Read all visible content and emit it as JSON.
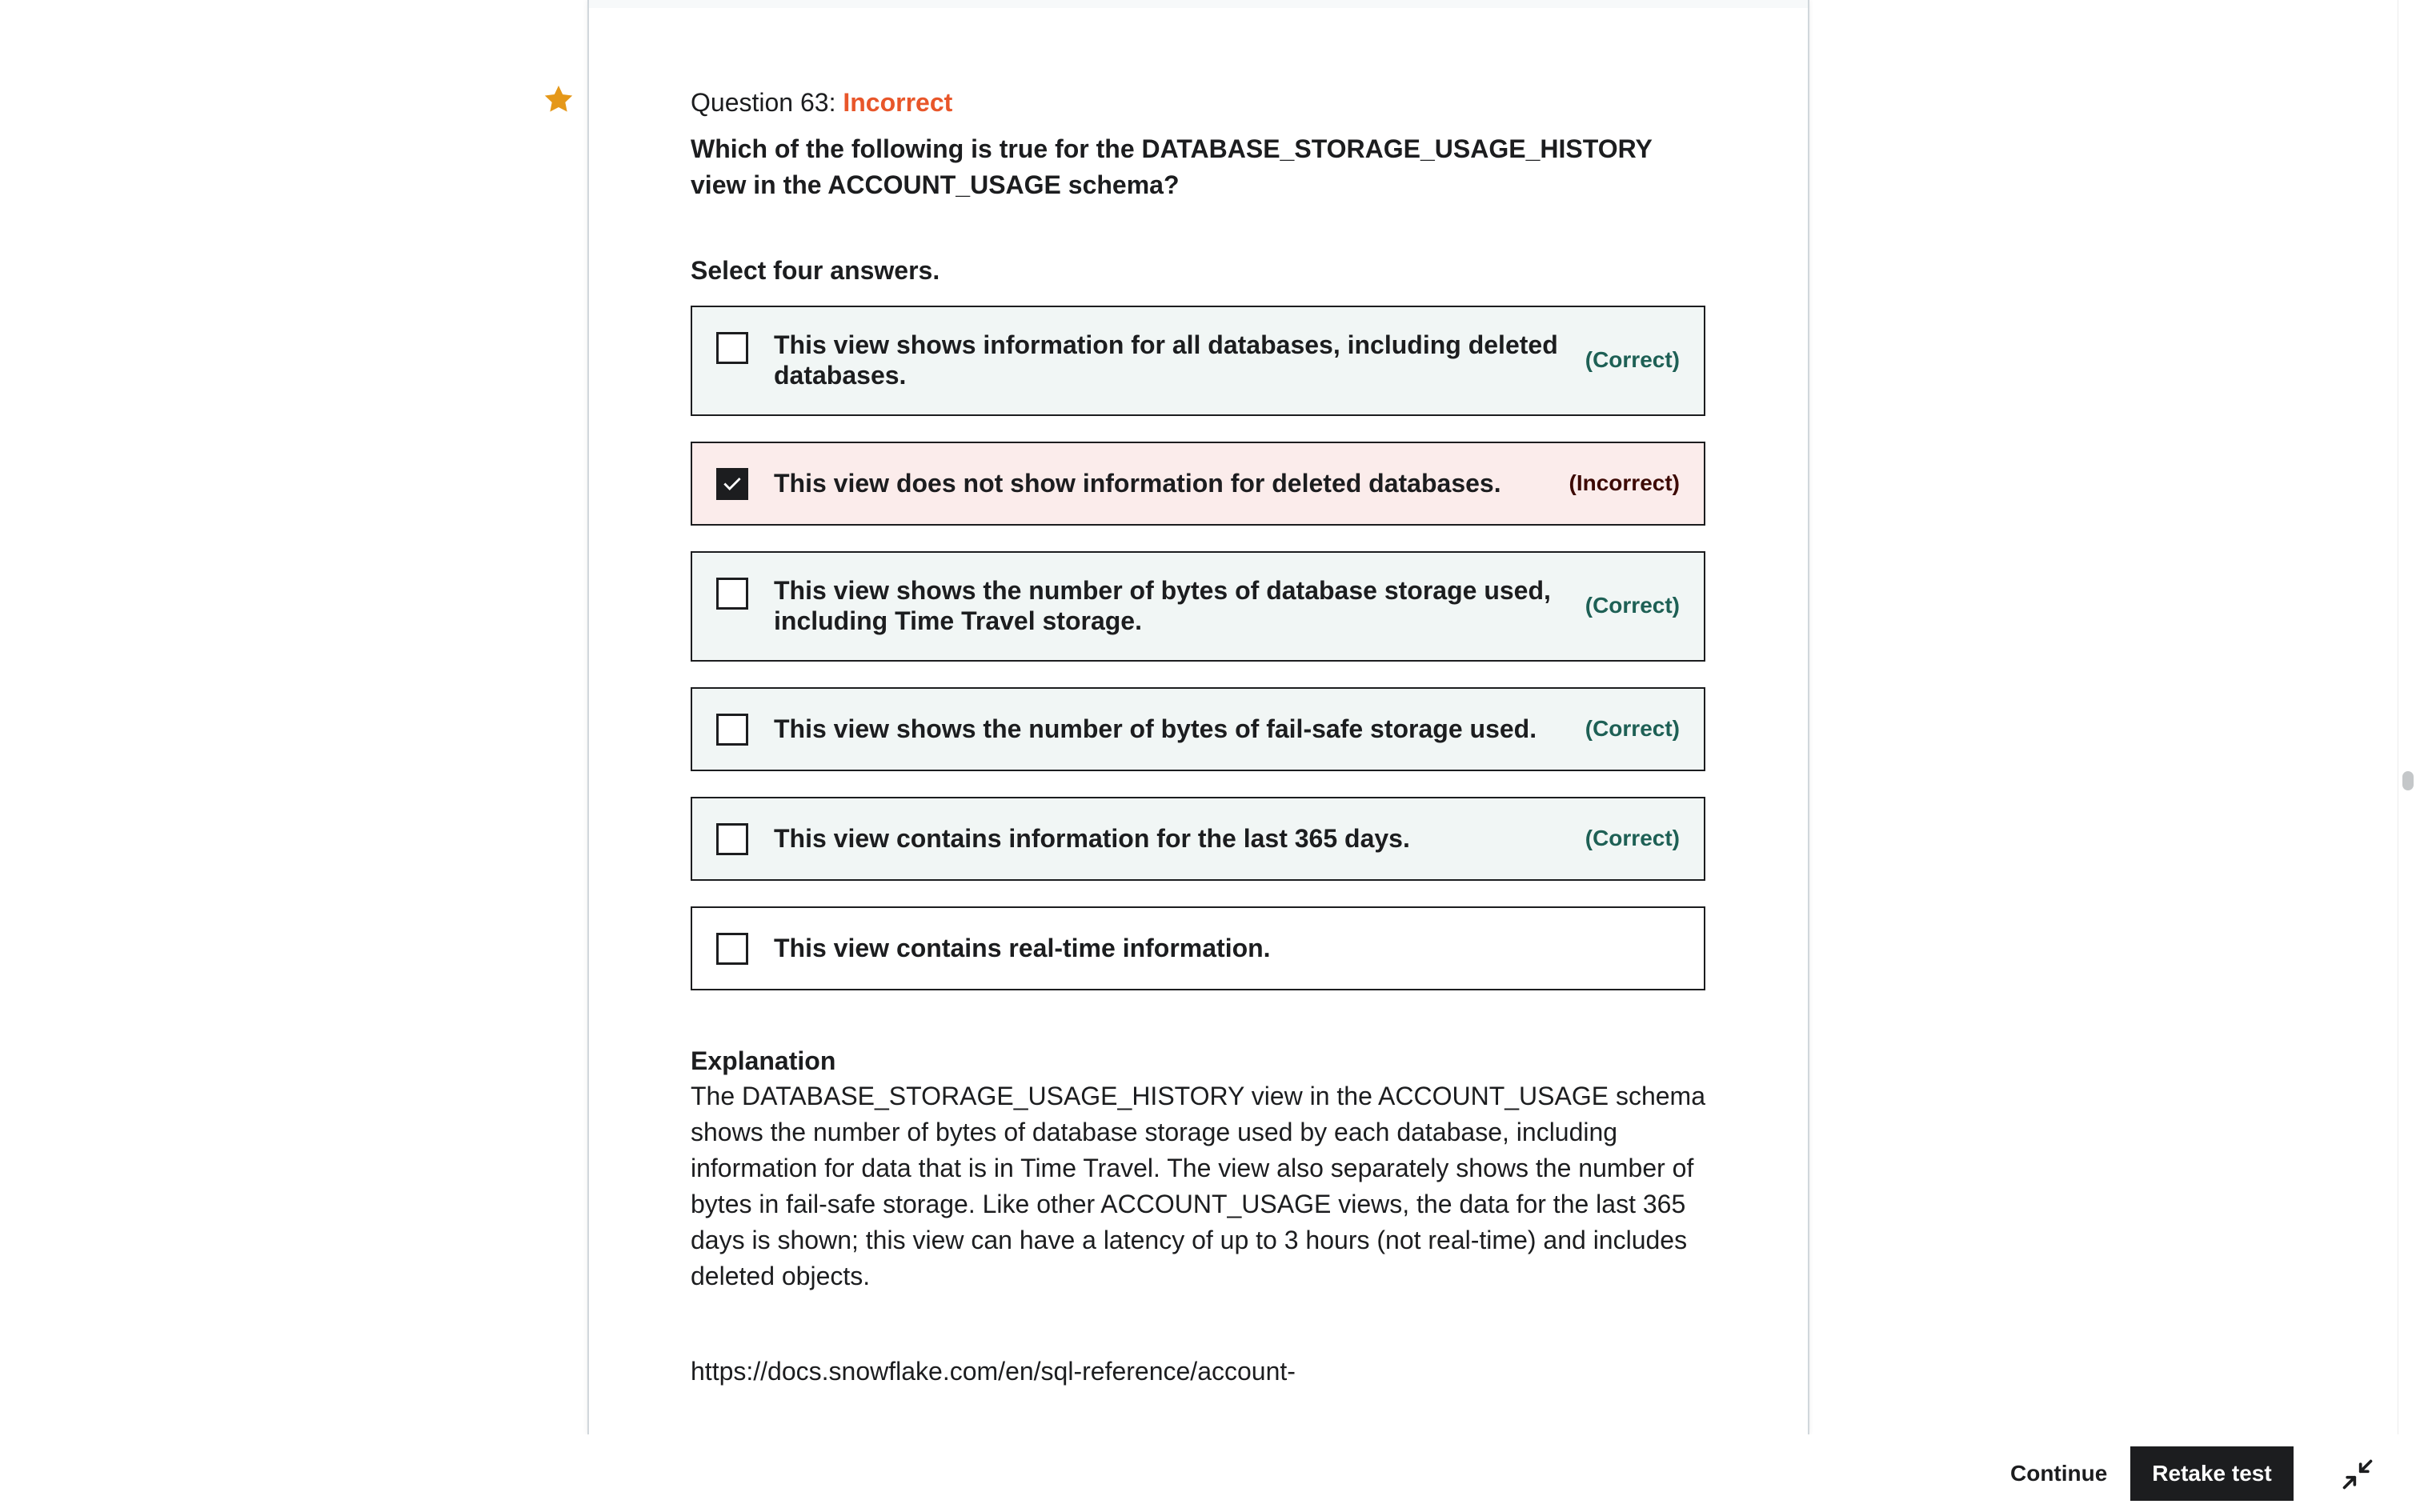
{
  "question": {
    "label": "Question 63:",
    "status": "Incorrect",
    "text": "Which of the following is true for the DATABASE_STORAGE_USAGE_HISTORY view in the ACCOUNT_USAGE schema?",
    "hint": "Select four answers."
  },
  "answers": [
    {
      "text": "This view shows information for all databases, including deleted databases.",
      "tag": "(Correct)",
      "checked": false
    },
    {
      "text": "This view does not show information for deleted databases.",
      "tag": "(Incorrect)",
      "checked": true
    },
    {
      "text": "This view shows the number of bytes of database storage used, including Time Travel storage.",
      "tag": "(Correct)",
      "checked": false
    },
    {
      "text": "This view shows the number of bytes of fail-safe storage used.",
      "tag": "(Correct)",
      "checked": false
    },
    {
      "text": "This view contains information for the last 365 days.",
      "tag": "(Correct)",
      "checked": false
    },
    {
      "text": "This view contains real-time information.",
      "tag": "",
      "checked": false
    }
  ],
  "explanation": {
    "title": "Explanation",
    "body": "The DATABASE_STORAGE_USAGE_HISTORY view in the ACCOUNT_USAGE schema shows the number of bytes of database storage used by each database, including information for data that is in Time Travel. The view also separately shows the number of bytes in fail-safe storage. Like other ACCOUNT_USAGE views, the data for the last 365 days is shown; this view can have a latency of up to 3 hours (not real-time) and includes deleted objects.",
    "link": "https://docs.snowflake.com/en/sql-reference/account-"
  },
  "footer": {
    "continue_label": "Continue",
    "retake_label": "Retake test"
  },
  "icons": {
    "star": "star-icon",
    "checkmark": "checkmark-icon",
    "collapse": "collapse-icon"
  },
  "colors": {
    "incorrect_accent": "#e8562a",
    "correct_tag": "#1e6055",
    "correct_bg": "#f1f6f5",
    "incorrect_bg": "#fbeceb",
    "star": "#e59819",
    "button_dark": "#1c1d1f"
  }
}
